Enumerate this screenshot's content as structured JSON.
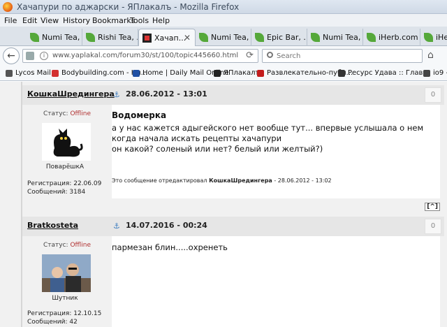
{
  "window": {
    "title": "Хачапури по аджарски - ЯПлакалъ - Mozilla Firefox"
  },
  "menu": [
    "File",
    "Edit",
    "View",
    "History",
    "Bookmarks",
    "Tools",
    "Help"
  ],
  "tabs": [
    {
      "label": "Numi Tea, ..."
    },
    {
      "label": "Rishi Tea, ..."
    },
    {
      "label": "Хачап...",
      "active": true
    },
    {
      "label": "Numi Tea, ..."
    },
    {
      "label": "Epic Bar, ..."
    },
    {
      "label": "Numi Tea, ..."
    },
    {
      "label": "iHerb.com ..."
    },
    {
      "label": "iHe"
    }
  ],
  "nav": {
    "url": "www.yaplakal.com/forum30/st/100/topic445660.html",
    "search_placeholder": "Search"
  },
  "bookmarks": [
    {
      "label": "Lycos Mail",
      "color": "#555555"
    },
    {
      "label": "Bodybuilding.com - Hu...",
      "color": "#d33030"
    },
    {
      "label": "Home | Daily Mail Online",
      "color": "#1f4fa3"
    },
    {
      "label": "ЯПлакалъ",
      "color": "#222222"
    },
    {
      "label": "Развлекательно-публ...",
      "color": "#c31c1c"
    },
    {
      "label": "Ресурс Удава :: Глав...",
      "color": "#333333"
    },
    {
      "label": "io9 - ",
      "color": "#444444"
    }
  ],
  "posts": [
    {
      "author": "КошкаШредингера",
      "anchor": "⚓",
      "date": "28.06.2012 - 13:01",
      "num": "0",
      "status_label": "Статус:",
      "status_value": "Offline",
      "rank": "ПоварёшкА",
      "reg": "Регистрация: 22.06.09",
      "msgs": "Сообщений: 3184",
      "subject": "Водомерка",
      "lines": [
        "а у нас кажется адыгейского нет вообще тут... впервые услышала о нем",
        "когда начала искать рецепты хачапури",
        "он какой? соленый или нет? белый или желтый?)"
      ],
      "edited_prefix": "Это сообщение отредактировал",
      "edited_user": "КошкаШредингера",
      "edited_date": "- 28.06.2012 - 13:02",
      "up": "[^]"
    },
    {
      "author": "Bratkosteta",
      "anchor": "⚓",
      "date": "14.07.2016 - 00:24",
      "num": "0",
      "status_label": "Статус:",
      "status_value": "Offline",
      "rank": "Шутник",
      "reg": "Регистрация: 12.10.15",
      "msgs": "Сообщений: 42",
      "lines": [
        "пармезан блин.....охренеть"
      ]
    }
  ]
}
